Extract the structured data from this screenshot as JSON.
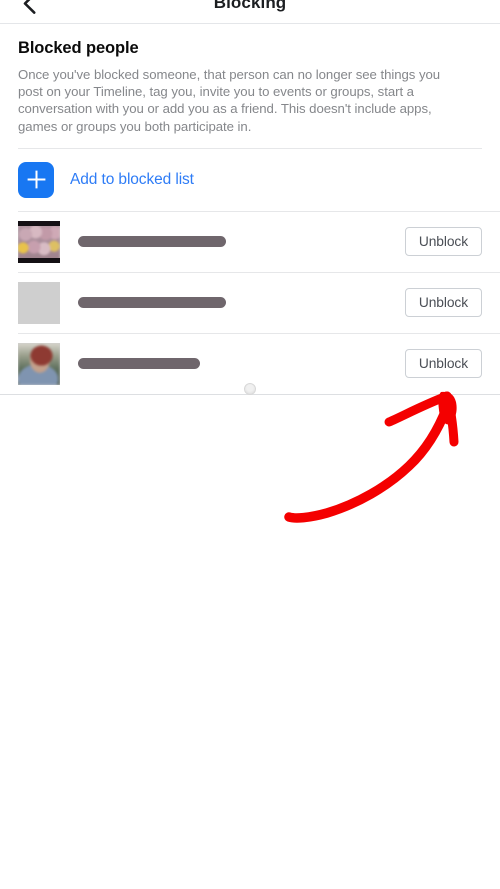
{
  "navbar": {
    "title": "Blocking",
    "back_icon": "back-chevron-icon"
  },
  "section": {
    "title": "Blocked people",
    "description": "Once you've blocked someone, that person can no longer see things you post on your Timeline, tag you, invite you to events or groups, start a conversation with you or add you as a friend. This doesn't include apps, games or groups you both participate in."
  },
  "add_row": {
    "label": "Add to blocked list",
    "icon": "plus-icon"
  },
  "blocked_people": [
    {
      "avatar": "crowd-photo-avatar",
      "name_redacted": true,
      "redaction_width": 148,
      "action_label": "Unblock"
    },
    {
      "avatar": "sunglasses-person-avatar",
      "name_redacted": true,
      "redaction_width": 148,
      "action_label": "Unblock"
    },
    {
      "avatar": "outdoor-person-avatar",
      "name_redacted": true,
      "redaction_width": 122,
      "action_label": "Unblock"
    }
  ],
  "loading": {
    "icon": "loading-spinner-icon"
  },
  "annotation": {
    "type": "hand-drawn-arrow",
    "color": "#f40000",
    "direction": "up-right"
  },
  "colors": {
    "accent_blue": "#1877f2",
    "link_blue": "#2e7cf6",
    "text_primary": "#0b0b0b",
    "text_secondary": "#85878b",
    "button_text": "#4b4f56",
    "button_border": "#ccd0d5",
    "divider": "#e6e7e9",
    "redaction": "#6f666c",
    "annotation_red": "#f40000"
  }
}
